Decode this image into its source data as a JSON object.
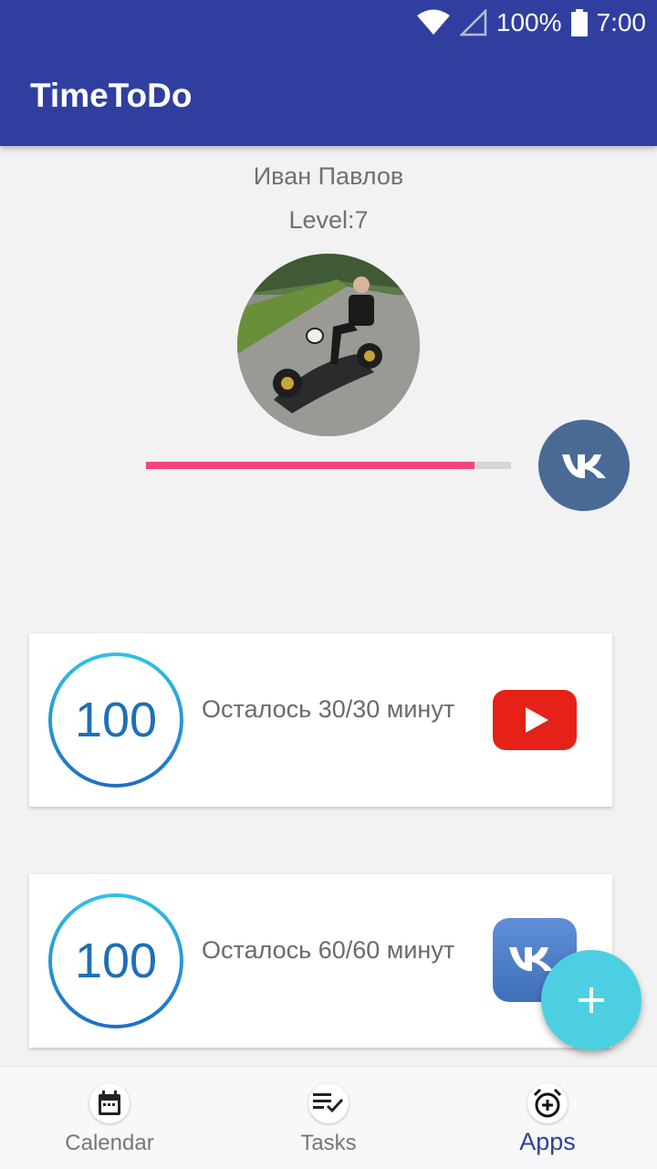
{
  "status_bar": {
    "battery": "100%",
    "time": "7:00"
  },
  "app_bar": {
    "title": "TimeToDo"
  },
  "profile": {
    "name": "Иван Павлов",
    "level": "Level:7",
    "progress": 0.9,
    "social_icon": "vk-icon"
  },
  "cards": [
    {
      "value": "100",
      "text": "Осталось 30/30 минут",
      "app_icon": "youtube-icon",
      "ring_progress": 1.0
    },
    {
      "value": "100",
      "text": "Осталось 60/60 минут",
      "app_icon": "vk-app-icon",
      "ring_progress": 1.0
    }
  ],
  "fab": {
    "icon": "plus-icon"
  },
  "bottom_nav": [
    {
      "label": "Calendar",
      "icon": "calendar-icon"
    },
    {
      "label": "Tasks",
      "icon": "checklist-icon"
    },
    {
      "label": "Apps",
      "icon": "alarm-clock-icon",
      "active": true
    }
  ],
  "colors": {
    "primary": "#303f9f",
    "accent_pink": "#f2457a",
    "fab": "#4cd0e1",
    "vk_blue": "#4a6a96",
    "youtube_red": "#e62117"
  }
}
